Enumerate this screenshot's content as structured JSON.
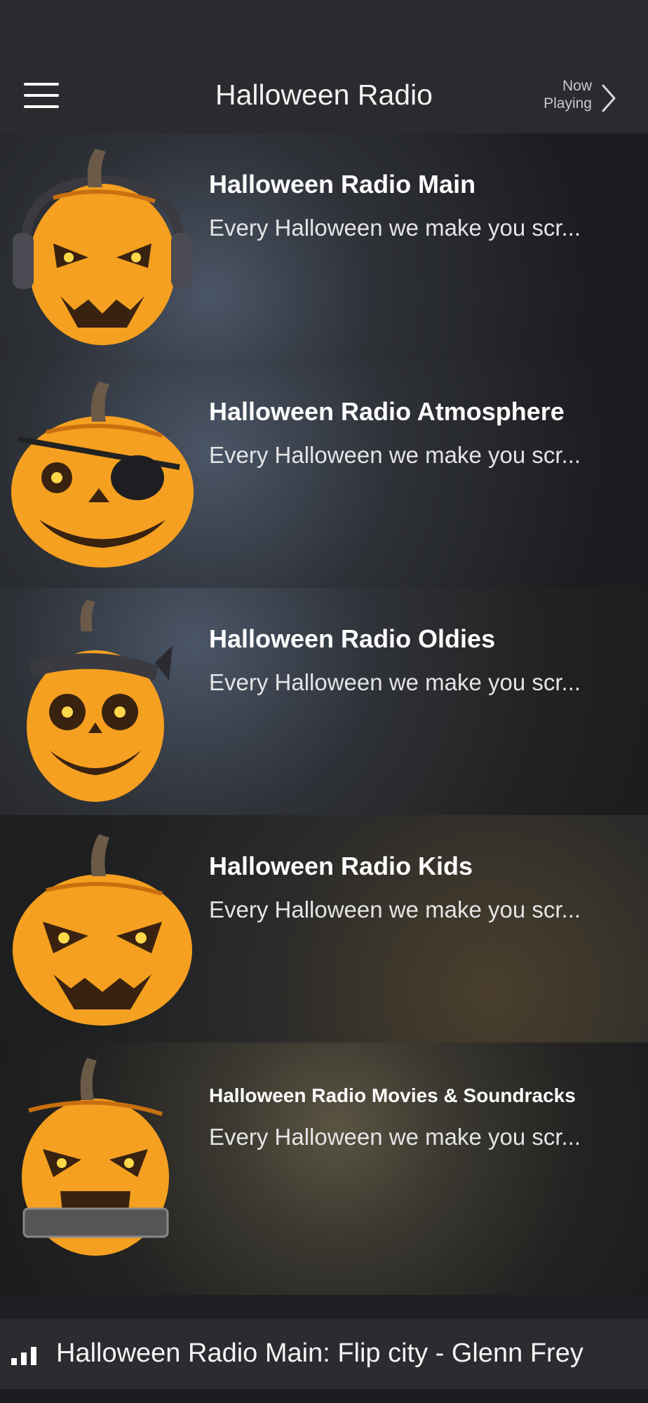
{
  "header": {
    "title": "Halloween Radio",
    "now_playing_line1": "Now",
    "now_playing_line2": "Playing"
  },
  "stations": [
    {
      "name": "Halloween Radio Main",
      "description": "Every Halloween we make you scr...",
      "icon": "pumpkin-headphones-icon"
    },
    {
      "name": "Halloween Radio Atmosphere",
      "description": "Every Halloween we make you scr...",
      "icon": "pumpkin-eyepatch-icon"
    },
    {
      "name": "Halloween Radio Oldies",
      "description": "Every Halloween we make you scr...",
      "icon": "pumpkin-bandana-icon"
    },
    {
      "name": "Halloween Radio Kids",
      "description": "Every Halloween we make you scr...",
      "icon": "pumpkin-kids-icon"
    },
    {
      "name": "Halloween Radio Movies & Soundracks",
      "description": "Every Halloween we make you scr...",
      "icon": "pumpkin-film-icon"
    }
  ],
  "player": {
    "now_playing_text": "Halloween Radio Main: Flip city - Glenn Frey"
  },
  "colors": {
    "header_bg": "#2a2a2f",
    "pumpkin": "#f5a020",
    "eye_glow": "#ffd84a"
  }
}
